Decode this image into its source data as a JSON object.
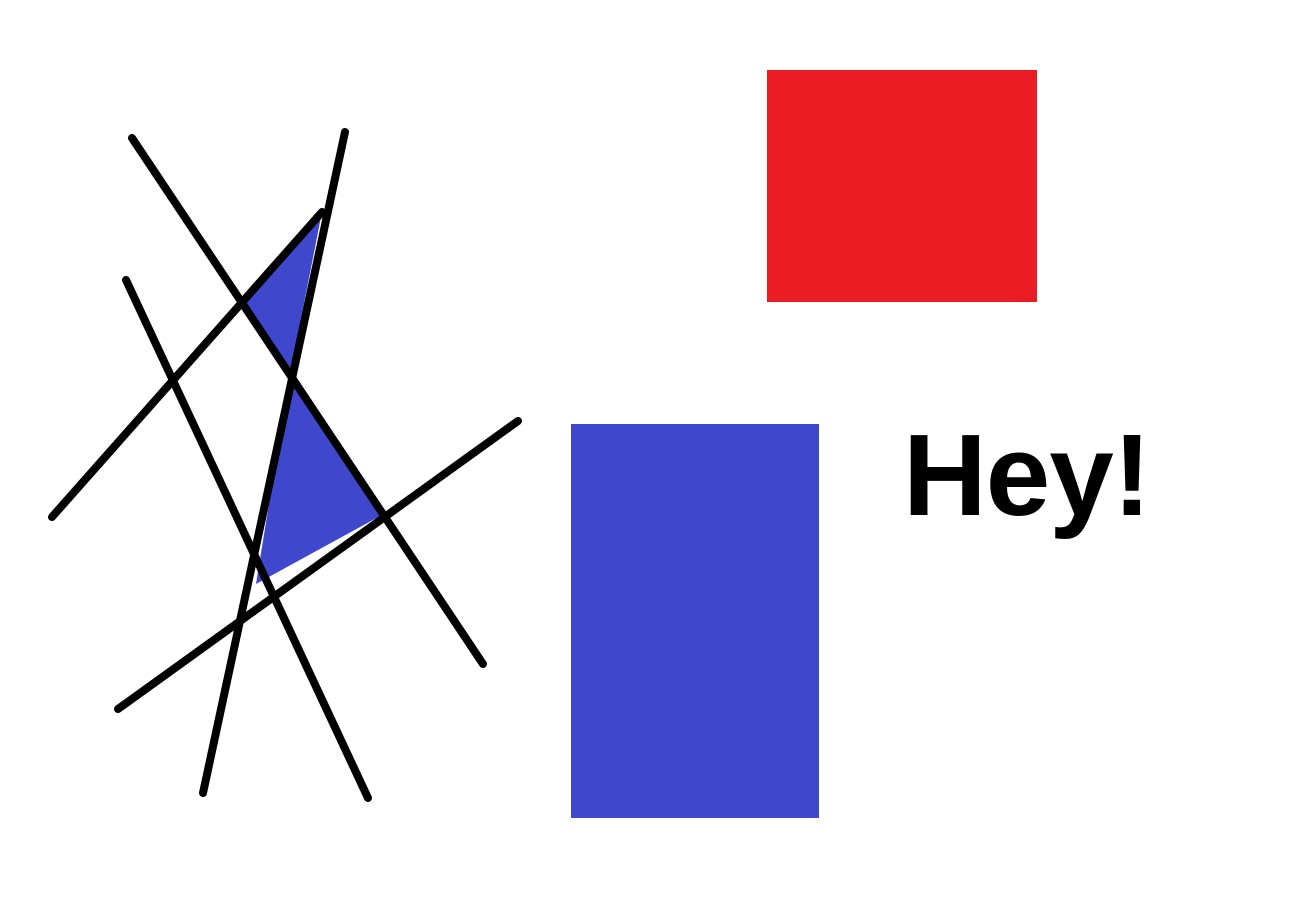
{
  "colors": {
    "background": "#ffffff",
    "red_rectangle": "#ec1c24",
    "blue_rectangle": "#3f48cc",
    "triangle_fill": "#3f48cc",
    "line_stroke": "#000000",
    "text": "#000000"
  },
  "greeting": {
    "text": "Hey!"
  }
}
